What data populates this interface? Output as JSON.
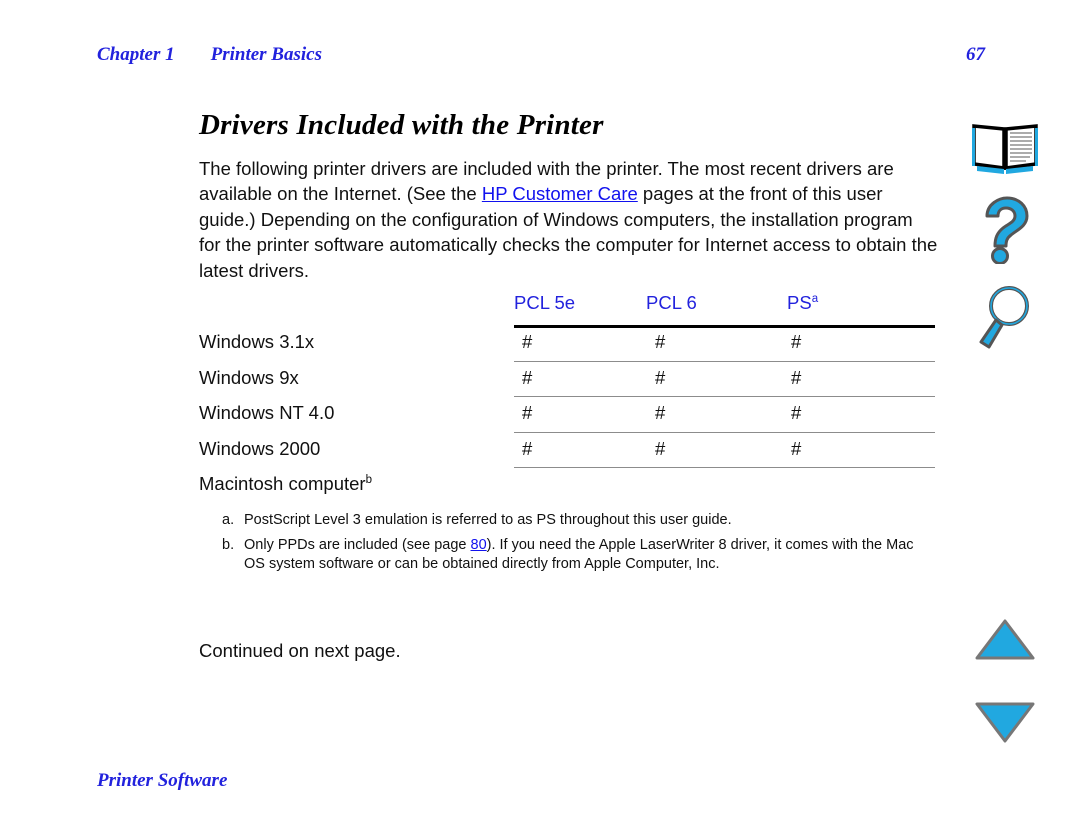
{
  "header": {
    "chapter": "Chapter 1",
    "section": "Printer Basics",
    "page_number": "67"
  },
  "title": "Drivers Included with the Printer",
  "body": {
    "part1": "The following printer drivers are included with the printer. The most recent drivers are available on the Internet. (See the ",
    "link": "HP Customer Care",
    "part2": " pages at the front of this user guide.) Depending on the configuration of Windows computers, the installation program for the printer software automatically checks the computer for Internet access to obtain the latest drivers."
  },
  "table": {
    "columns": [
      {
        "label": "PCL 5e",
        "superscript": ""
      },
      {
        "label": "PCL 6",
        "superscript": ""
      },
      {
        "label": "PS",
        "superscript": "a"
      }
    ],
    "rows": [
      {
        "label": "Windows 3.1x",
        "superscript": "",
        "cells": [
          "#",
          "#",
          "#"
        ]
      },
      {
        "label": "Windows 9x",
        "superscript": "",
        "cells": [
          "#",
          "#",
          "#"
        ]
      },
      {
        "label": "Windows NT 4.0",
        "superscript": "",
        "cells": [
          "#",
          "#",
          "#"
        ]
      },
      {
        "label": "Windows 2000",
        "superscript": "",
        "cells": [
          "#",
          "#",
          "#"
        ]
      },
      {
        "label": "Macintosh computer",
        "superscript": "b",
        "cells": [
          "",
          "",
          ""
        ]
      }
    ]
  },
  "footnotes": [
    {
      "marker": "a.",
      "text": "PostScript Level 3 emulation is referred to as PS throughout this user guide."
    },
    {
      "marker": "b.",
      "part1": "Only PPDs are included (see page ",
      "link": "80",
      "part2": "). If you need the Apple LaserWriter 8 driver, it comes with the Mac OS system software or can be obtained directly from Apple Computer, Inc."
    }
  ],
  "continued": "Continued on next page.",
  "footer": {
    "section": "Printer Software"
  },
  "rail": {
    "book_icon": "book-icon",
    "help_icon": "question-mark-icon",
    "find_icon": "magnifier-icon",
    "up_icon": "triangle-up-icon",
    "down_icon": "triangle-down-icon"
  },
  "colors": {
    "accent_blue": "#2222dd",
    "link_blue": "#1111ee",
    "icon_cyan": "#21a8e0",
    "icon_outline": "#555555",
    "rule_gray": "#8c8c8c",
    "rule_black": "#000000"
  }
}
